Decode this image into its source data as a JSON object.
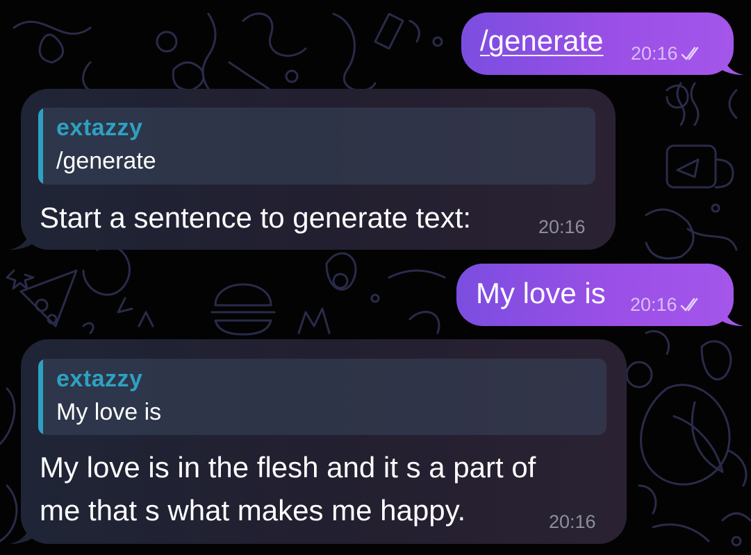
{
  "messages": [
    {
      "direction": "outgoing",
      "text": "/generate",
      "time": "20:16",
      "status_icon": "double-check-icon"
    },
    {
      "direction": "incoming",
      "reply_to": {
        "author": "extazzy",
        "text": "/generate"
      },
      "text": "Start a sentence to generate text:",
      "time": "20:16"
    },
    {
      "direction": "outgoing",
      "text": "My love is",
      "time": "20:16",
      "status_icon": "double-check-icon"
    },
    {
      "direction": "incoming",
      "reply_to": {
        "author": "extazzy",
        "text": "My love is"
      },
      "text_lines": [
        "My love is in the flesh and it s a part of",
        "me that s what makes me happy."
      ],
      "time": "20:16"
    }
  ],
  "colors": {
    "outgoing_bubble": "#9a4fe6",
    "incoming_bubble": "#221f30",
    "reply_accent": "#2ea1c2",
    "background": "#030303",
    "doodle": "#2a2b4a"
  }
}
